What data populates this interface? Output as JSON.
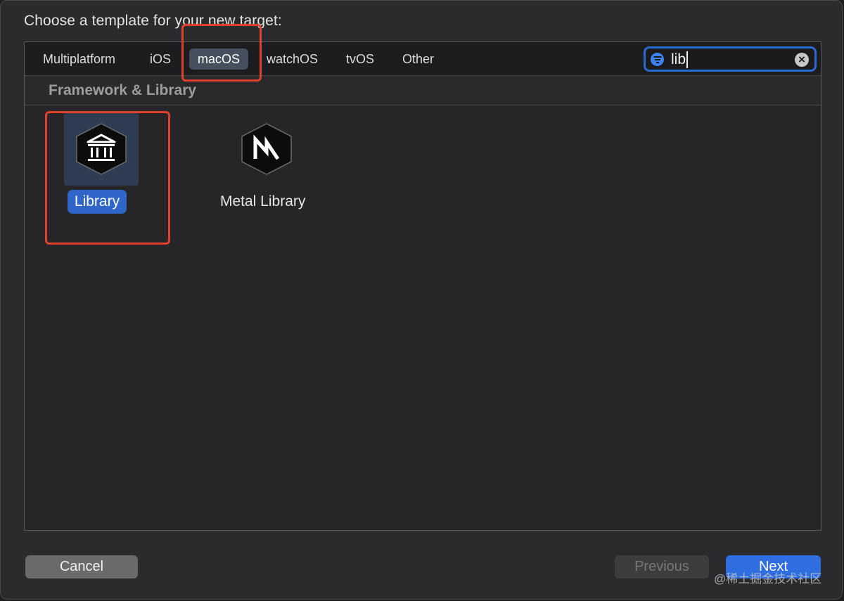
{
  "dialog": {
    "prompt": "Choose a template for your new target:"
  },
  "platform_tabs": [
    {
      "label": "Multiplatform",
      "selected": false
    },
    {
      "label": "iOS",
      "selected": false
    },
    {
      "label": "macOS",
      "selected": true
    },
    {
      "label": "watchOS",
      "selected": false
    },
    {
      "label": "tvOS",
      "selected": false
    },
    {
      "label": "Other",
      "selected": false
    }
  ],
  "search": {
    "value": "lib",
    "filter_icon": "filter-icon",
    "clear_icon": "clear-icon"
  },
  "section": {
    "title": "Framework & Library"
  },
  "templates": [
    {
      "label": "Library",
      "icon": "library-building-icon",
      "selected": true
    },
    {
      "label": "Metal Library",
      "icon": "metal-m-icon",
      "selected": false
    }
  ],
  "buttons": {
    "cancel": "Cancel",
    "previous": "Previous",
    "next": "Next"
  },
  "watermark": "@稀土掘金技术社区",
  "colors": {
    "accent": "#2f6ee0",
    "highlight_annotation": "#e0402e",
    "selected_tab": "#46505c"
  }
}
